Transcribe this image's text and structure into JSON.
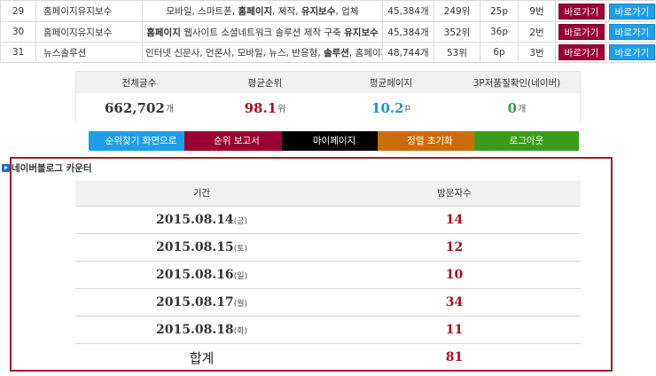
{
  "keyword_rows": [
    {
      "no": "29",
      "keyword": "홈페이지유지보수",
      "desc_parts": [
        {
          "t": "모바일, 스마트폰, ",
          "b": false
        },
        {
          "t": "홈페이지",
          "b": true
        },
        {
          "t": ", 제작, ",
          "b": false
        },
        {
          "t": "유지보수",
          "b": true
        },
        {
          "t": ", 업체",
          "b": false
        }
      ],
      "count": "45,384개",
      "rank": "249위",
      "page": "25p",
      "position": "9번",
      "btn_red": "바로가기",
      "btn_blue": "바로가기"
    },
    {
      "no": "30",
      "keyword": "홈페이지유지보수",
      "desc_parts": [
        {
          "t": "홈페이지",
          "b": true
        },
        {
          "t": " 웹사이트 소셜네트워크 솔루션 제작 구축 ",
          "b": false
        },
        {
          "t": "유지보수",
          "b": true
        }
      ],
      "count": "45,384개",
      "rank": "352위",
      "page": "36p",
      "position": "2번",
      "btn_red": "바로가기",
      "btn_blue": "바로가기"
    },
    {
      "no": "31",
      "keyword": "뉴스솔루션",
      "desc_parts": [
        {
          "t": "인터넷 신문사, 언론사, 모바일, 뉴스, 반응형, ",
          "b": false
        },
        {
          "t": "솔루션",
          "b": true
        },
        {
          "t": ", 홈페이지...",
          "b": false
        }
      ],
      "count": "48,744개",
      "rank": "53위",
      "page": "6p",
      "position": "3번",
      "btn_red": "바로가기",
      "btn_blue": "바로가기"
    }
  ],
  "stats": {
    "headers": [
      "전체글수",
      "평균순위",
      "평균페이지",
      "3P저품질확인(네이버)"
    ],
    "values": [
      {
        "num": "662,702",
        "unit": "개",
        "color": "#333333"
      },
      {
        "num": "98.1",
        "unit": "위",
        "color": "#a50f1b"
      },
      {
        "num": "10.2",
        "unit": "p",
        "color": "#1e90d8"
      },
      {
        "num": "0",
        "unit": "개",
        "color": "#2fa52f"
      }
    ]
  },
  "actions": [
    {
      "label": "순위찾기 화면으로",
      "color": "#1e9ee8"
    },
    {
      "label": "순위 보고서",
      "color": "#9a0033"
    },
    {
      "label": "마이페이지",
      "color": "#000000"
    },
    {
      "label": "정렬 초기화",
      "color": "#cc6d0b"
    },
    {
      "label": "로그아웃",
      "color": "#3a9c1c"
    }
  ],
  "counter": {
    "title": "네이버블로그 카운터",
    "col_period": "기간",
    "col_visitors": "방문자수",
    "rows": [
      {
        "date": "2015.08.14",
        "day": "(금)",
        "visits": "14"
      },
      {
        "date": "2015.08.15",
        "day": "(토)",
        "visits": "12"
      },
      {
        "date": "2015.08.16",
        "day": "(일)",
        "visits": "10"
      },
      {
        "date": "2015.08.17",
        "day": "(월)",
        "visits": "34"
      },
      {
        "date": "2015.08.18",
        "day": "(화)",
        "visits": "11"
      }
    ],
    "total_label": "합계",
    "total_value": "81"
  }
}
